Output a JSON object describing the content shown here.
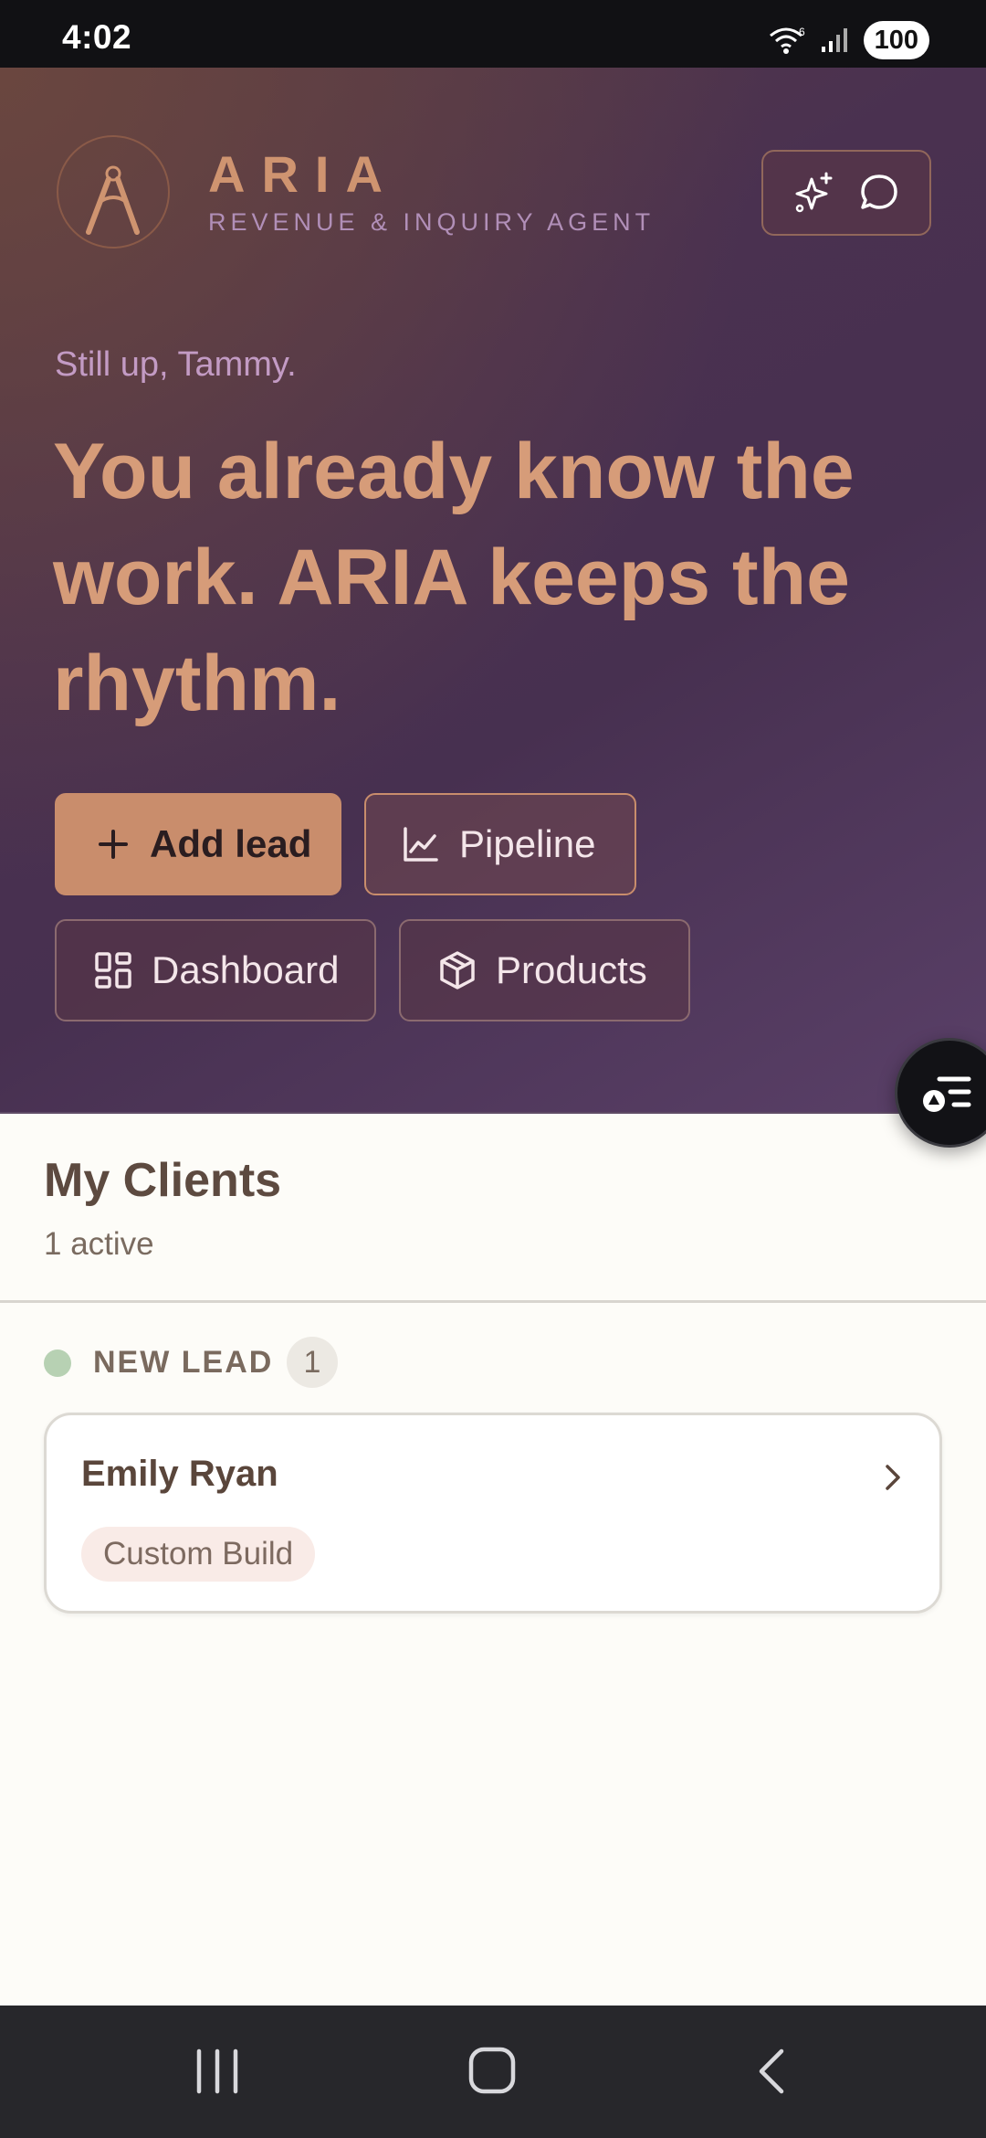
{
  "status_bar": {
    "time": "4:02",
    "network": "6",
    "battery": "100"
  },
  "brand": {
    "name": "ARIA",
    "subtitle": "REVENUE & INQUIRY AGENT",
    "logo_letter": "A"
  },
  "header_actions": {
    "icons": [
      "sparkles-icon",
      "chat-bubble-icon"
    ]
  },
  "hero": {
    "greeting": "Still up, Tammy.",
    "headline": "You already know the work. ARIA keeps the rhythm."
  },
  "actions": {
    "add_lead": "Add lead",
    "pipeline": "Pipeline",
    "dashboard": "Dashboard",
    "products": "Products"
  },
  "clients": {
    "title": "My Clients",
    "subtitle": "1 active",
    "stages": [
      {
        "label": "NEW LEAD",
        "count": "1",
        "items": [
          {
            "name": "Emily Ryan",
            "tag": "Custom Build"
          }
        ]
      }
    ]
  },
  "colors": {
    "accent": "#c98d6c",
    "hero_bg": "#4a3150",
    "page_bg": "#fdfcf8",
    "stage_new_lead": "#b7d1b3"
  }
}
